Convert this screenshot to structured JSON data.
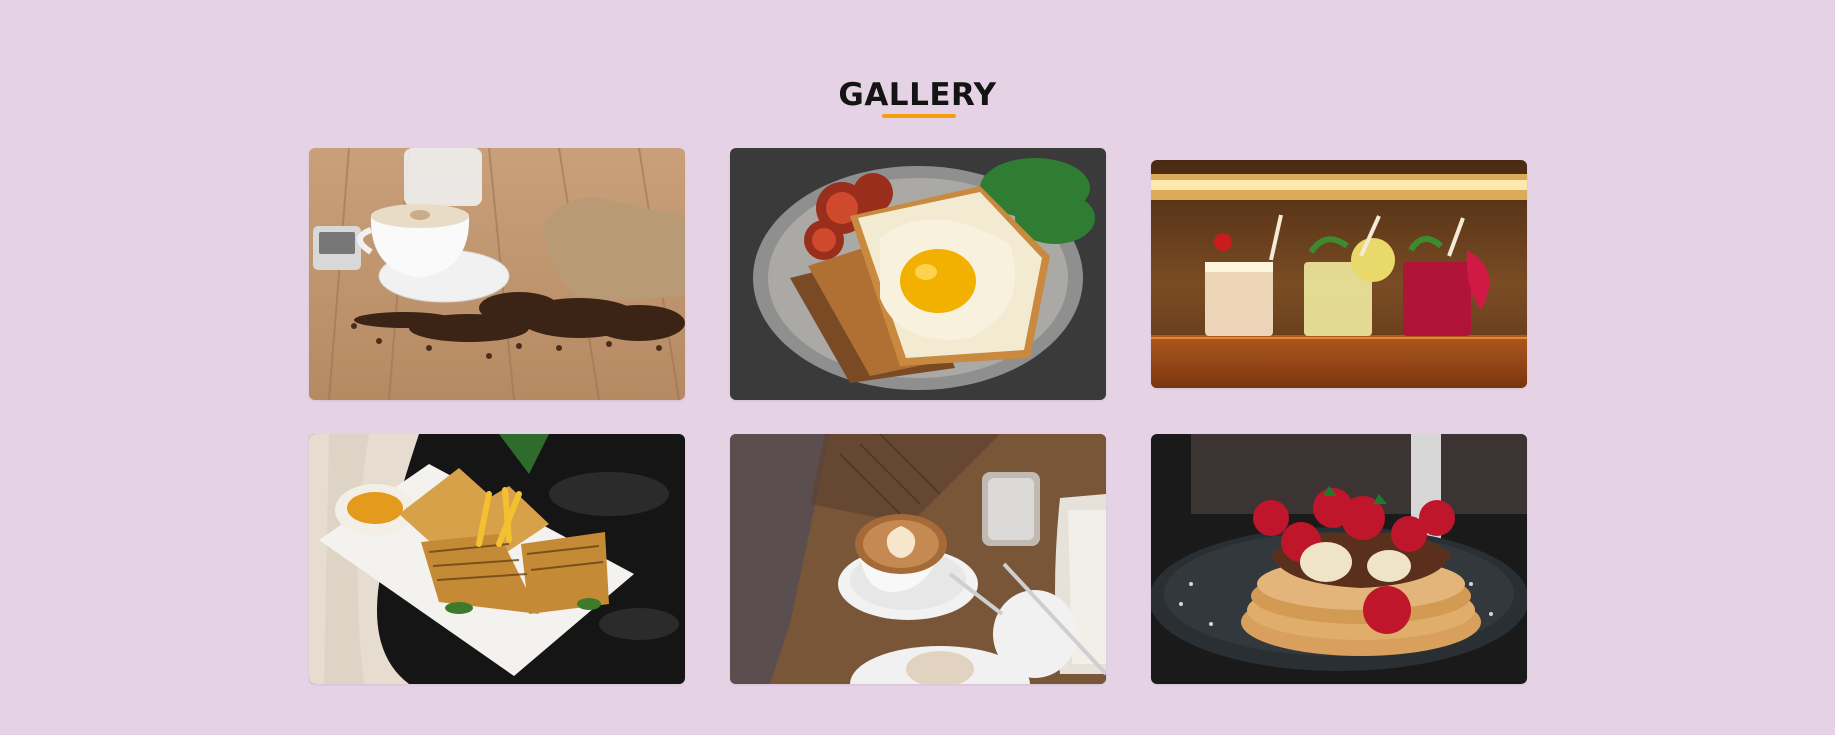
{
  "gallery": {
    "title": "GALLERY",
    "accent_color": "#f59e0b",
    "background_color": "#e5d3e5",
    "images": [
      {
        "name": "coffee-beans-cup-photo"
      },
      {
        "name": "toast-fried-egg-photo"
      },
      {
        "name": "cocktails-bar-photo"
      },
      {
        "name": "grilled-sandwich-fries-photo"
      },
      {
        "name": "latte-art-cafe-table-photo"
      },
      {
        "name": "pancakes-strawberries-photo"
      }
    ]
  }
}
